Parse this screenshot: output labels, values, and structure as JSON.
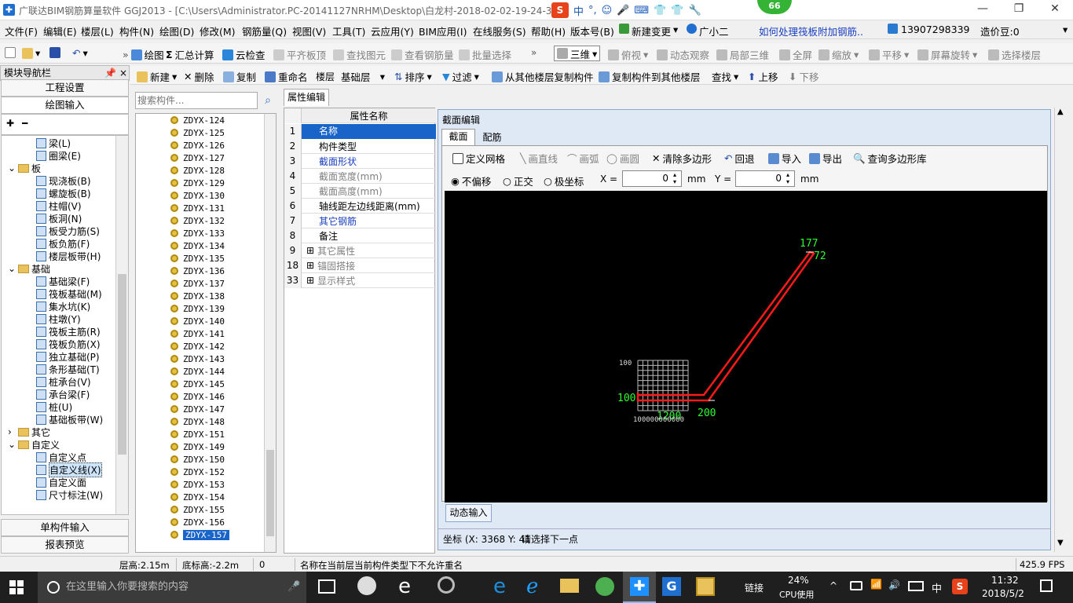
{
  "window": {
    "title": "广联达BIM钢筋算量软件 GGJ2013 - [C:\\Users\\Administrator.PC-20141127NRHM\\Desktop\\白龙村-2018-02-02-19-24-35",
    "ime_items": [
      "中",
      "°,",
      "☺",
      "🎤",
      "⌨",
      "👕",
      "👕",
      "🔧"
    ],
    "badge": "66",
    "min_glyph": "—",
    "restore_glyph": "❐",
    "close_glyph": "✕"
  },
  "menu": {
    "items": [
      "文件(F)",
      "编辑(E)",
      "楼层(L)",
      "构件(N)",
      "绘图(D)",
      "修改(M)",
      "钢筋量(Q)",
      "视图(V)",
      "工具(T)",
      "云应用(Y)",
      "BIM应用(I)",
      "在线服务(S)",
      "帮助(H)",
      "版本号(B)"
    ],
    "new_change": "新建变更",
    "guangxiaoer": "广小二",
    "question": "如何处理筏板附加钢筋..",
    "phone": "13907298339",
    "price_bean": "造价豆:0"
  },
  "toolbar1": {
    "draw": "绘图",
    "sum": "汇总计算",
    "cloud_check": "云检查",
    "flat_slab": "平齐板顶",
    "find_elem": "查找图元",
    "view_rebar": "查看钢筋量",
    "batch_select": "批量选择",
    "view_mode": "三维",
    "top_view": "俯视",
    "dynamic": "动态观察",
    "local3d": "局部三维",
    "fullscreen": "全屏",
    "zoom": "缩放",
    "pan": "平移",
    "rotate": "屏幕旋转",
    "select_floor": "选择楼层"
  },
  "toolbar2": {
    "new": "新建",
    "delete": "删除",
    "copy": "复制",
    "rename": "重命名",
    "floor_label": "楼层",
    "floor_value": "基础层",
    "sort": "排序",
    "filter": "过滤",
    "copy_from": "从其他楼层复制构件",
    "copy_to": "复制构件到其他楼层",
    "find": "查找",
    "up": "上移",
    "down": "下移"
  },
  "nav": {
    "header": "模块导航栏",
    "pin": "📌",
    "close": "×",
    "eng_settings": "工程设置",
    "drawing_input": "绘图输入",
    "single_input": "单构件输入",
    "report": "报表预览",
    "tree": [
      {
        "label": "梁(L)",
        "indent": 2
      },
      {
        "label": "圈梁(E)",
        "indent": 2
      },
      {
        "label": "板",
        "indent": 0,
        "folder": true
      },
      {
        "label": "现浇板(B)",
        "indent": 2
      },
      {
        "label": "螺旋板(B)",
        "indent": 2
      },
      {
        "label": "柱帽(V)",
        "indent": 2
      },
      {
        "label": "板洞(N)",
        "indent": 2
      },
      {
        "label": "板受力筋(S)",
        "indent": 2
      },
      {
        "label": "板负筋(F)",
        "indent": 2
      },
      {
        "label": "楼层板带(H)",
        "indent": 2
      },
      {
        "label": "基础",
        "indent": 0,
        "folder": true
      },
      {
        "label": "基础梁(F)",
        "indent": 2
      },
      {
        "label": "筏板基础(M)",
        "indent": 2
      },
      {
        "label": "集水坑(K)",
        "indent": 2
      },
      {
        "label": "柱墩(Y)",
        "indent": 2
      },
      {
        "label": "筏板主筋(R)",
        "indent": 2
      },
      {
        "label": "筏板负筋(X)",
        "indent": 2
      },
      {
        "label": "独立基础(P)",
        "indent": 2
      },
      {
        "label": "条形基础(T)",
        "indent": 2
      },
      {
        "label": "桩承台(V)",
        "indent": 2
      },
      {
        "label": "承台梁(F)",
        "indent": 2
      },
      {
        "label": "桩(U)",
        "indent": 2
      },
      {
        "label": "基础板带(W)",
        "indent": 2
      },
      {
        "label": "其它",
        "indent": 0,
        "folder": true,
        "collapsed": true
      },
      {
        "label": "自定义",
        "indent": 0,
        "folder": true
      },
      {
        "label": "自定义点",
        "indent": 2
      },
      {
        "label": "自定义线(X)",
        "indent": 2,
        "selected": true
      },
      {
        "label": "自定义面",
        "indent": 2
      },
      {
        "label": "尺寸标注(W)",
        "indent": 2
      }
    ]
  },
  "search": {
    "placeholder": "搜索构件..."
  },
  "components": [
    "ZDYX-124",
    "ZDYX-125",
    "ZDYX-126",
    "ZDYX-127",
    "ZDYX-128",
    "ZDYX-129",
    "ZDYX-130",
    "ZDYX-131",
    "ZDYX-132",
    "ZDYX-133",
    "ZDYX-134",
    "ZDYX-135",
    "ZDYX-136",
    "ZDYX-137",
    "ZDYX-138",
    "ZDYX-139",
    "ZDYX-140",
    "ZDYX-141",
    "ZDYX-142",
    "ZDYX-143",
    "ZDYX-144",
    "ZDYX-145",
    "ZDYX-146",
    "ZDYX-147",
    "ZDYX-148",
    "ZDYX-151",
    "ZDYX-149",
    "ZDYX-150",
    "ZDYX-152",
    "ZDYX-153",
    "ZDYX-154",
    "ZDYX-155",
    "ZDYX-156",
    "ZDYX-157"
  ],
  "props": {
    "tab": "属性编辑",
    "header": "属性名称",
    "rows": [
      {
        "no": "1",
        "name": "名称",
        "style": "selected"
      },
      {
        "no": "2",
        "name": "构件类型",
        "style": "normal"
      },
      {
        "no": "3",
        "name": "截面形状",
        "style": "blue"
      },
      {
        "no": "4",
        "name": "截面宽度(mm)",
        "style": "gray"
      },
      {
        "no": "5",
        "name": "截面高度(mm)",
        "style": "gray"
      },
      {
        "no": "6",
        "name": "轴线距左边线距离(mm)",
        "style": "normal"
      },
      {
        "no": "7",
        "name": "其它钢筋",
        "style": "blue"
      },
      {
        "no": "8",
        "name": "备注",
        "style": "normal"
      },
      {
        "no": "9",
        "name": "其它属性",
        "style": "gray",
        "expand": true
      },
      {
        "no": "18",
        "name": "锚固搭接",
        "style": "gray",
        "expand": true
      },
      {
        "no": "33",
        "name": "显示样式",
        "style": "gray",
        "expand": true
      }
    ]
  },
  "section": {
    "title": "截面编辑",
    "tabs": [
      "截面",
      "配筋"
    ],
    "tools": {
      "grid": "定义网格",
      "line": "画直线",
      "arc": "画弧",
      "circle": "画圆",
      "clear": "清除多边形",
      "undo": "回退",
      "import": "导入",
      "export": "导出",
      "query": "查询多边形库"
    },
    "coord_modes": [
      "不偏移",
      "正交",
      "极坐标"
    ],
    "x_label": "X =",
    "x_value": "0",
    "y_label": "Y =",
    "y_value": "0",
    "unit": "mm",
    "dyn_input": "动态输入",
    "coord_text": "坐标 (X: 3368 Y: 41",
    "prompt": "请选择下一点",
    "drawing_labels": {
      "top1": "177",
      "top2": "72",
      "left": "100",
      "bottom_mid": "1200",
      "bottom_right": "200",
      "grid_left": "100",
      "grid_bottom": "100000000000"
    }
  },
  "statusbar": {
    "floor_height": "层高:2.15m",
    "bottom_elev": "底标高:-2.2m",
    "zero": "0",
    "message": "名称在当前层当前构件类型下不允许重名",
    "fps": "425.9 FPS"
  },
  "taskbar": {
    "search": "在这里输入你要搜索的内容",
    "link": "链接",
    "cpu_pct": "24%",
    "cpu_label": "CPU使用",
    "lang": "中",
    "time": "11:32",
    "date": "2018/5/2"
  }
}
